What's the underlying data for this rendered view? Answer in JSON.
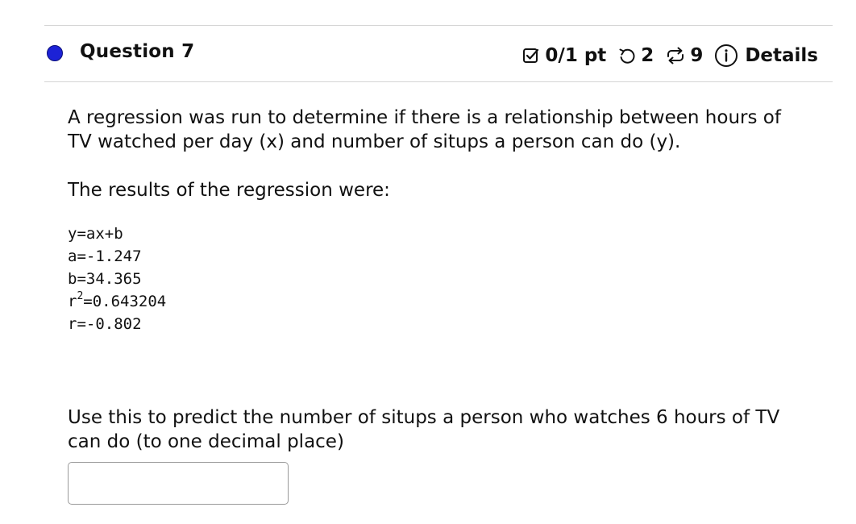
{
  "header": {
    "question_title": "Question 7",
    "score": "0/1 pt",
    "attempts": "2",
    "retries": "9",
    "details_label": "Details",
    "status_color": "#1c22d6",
    "icons": [
      "checkbox-icon",
      "undo-icon",
      "retry-icon",
      "info-icon"
    ]
  },
  "question": {
    "prompt": "A regression was run to determine if there is a relationship between hours of TV watched per day (x) and number of situps a person can do (y).",
    "results_label": "The results of the regression were:",
    "results": {
      "equation": "y=ax+b",
      "a": "a=-1.247",
      "b": "b=34.365",
      "r2_base": "r",
      "r2_exp": "2",
      "r2_value": "=0.643204",
      "r": "r=-0.802"
    },
    "task": "Use this to predict the number of situps a person who watches 6 hours of TV can do (to one decimal place)"
  },
  "answer": {
    "value": ""
  }
}
